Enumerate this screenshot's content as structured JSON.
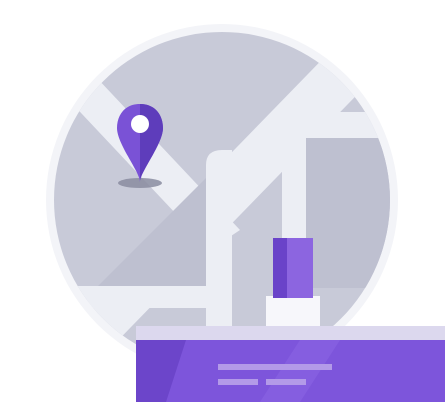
{
  "illustration": {
    "icons": [
      "map-circle-icon",
      "location-pin-icon",
      "storefront-window-icon"
    ],
    "colors": {
      "background": "#ffffff",
      "map_base": "#c8cad8",
      "road": "#eceef4",
      "map_rim": "#f3f4f8",
      "pin": "#7a52d6",
      "pin_dark": "#5e3dbb",
      "pin_shadow": "#8a8ca0",
      "building_light": "#8c65e0",
      "building_dark": "#6a43c9",
      "building_base": "#f7f7fb",
      "panel_top": "#dcd8ee",
      "panel": "#7d55db",
      "panel_dark": "#6c45ca",
      "panel_line": "#b39ae8"
    }
  }
}
